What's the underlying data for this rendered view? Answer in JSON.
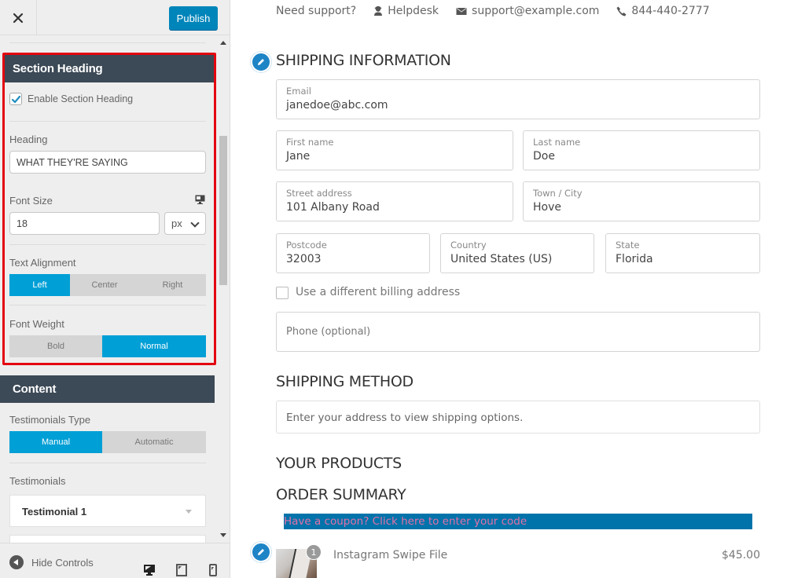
{
  "customizer": {
    "close_label": "Close",
    "publish_label": "Publish",
    "scroll_position": {
      "thumb_start_fraction": 0.18,
      "thumb_size_fraction": 0.31
    },
    "section_heading_panel": {
      "title": "Section Heading",
      "enable_checkbox": {
        "label": "Enable Section Heading",
        "checked": true
      },
      "heading": {
        "label": "Heading",
        "value": "WHAT THEY'RE SAYING"
      },
      "font_size": {
        "label": "Font Size",
        "value": "18",
        "unit": "px",
        "device_icon": "desktop-icon"
      },
      "text_alignment": {
        "label": "Text Alignment",
        "options": [
          "Left",
          "Center",
          "Right"
        ],
        "selected": "Left"
      },
      "font_weight": {
        "label": "Font Weight",
        "options": [
          "Bold",
          "Normal"
        ],
        "selected": "Normal"
      }
    },
    "content_panel": {
      "title": "Content",
      "testimonials_type": {
        "label": "Testimonials Type",
        "options": [
          "Manual",
          "Automatic"
        ],
        "selected": "Manual"
      },
      "testimonials": {
        "label": "Testimonials",
        "items": [
          "Testimonial 1"
        ]
      }
    },
    "footer": {
      "hide_controls_label": "Hide Controls",
      "devices": [
        "desktop",
        "tablet",
        "mobile"
      ],
      "active_device": "desktop"
    },
    "highlight_color": "#e3050f",
    "accent_color": "#009fd6"
  },
  "preview": {
    "support": {
      "prompt": "Need support?",
      "helpdesk": "Helpdesk",
      "email": "support@example.com",
      "phone": "844-440-2777"
    },
    "shipping_information": {
      "title": "SHIPPING INFORMATION",
      "fields": {
        "email": {
          "label": "Email",
          "value": "janedoe@abc.com"
        },
        "first_name": {
          "label": "First name",
          "value": "Jane"
        },
        "last_name": {
          "label": "Last name",
          "value": "Doe"
        },
        "street": {
          "label": "Street address",
          "value": "101 Albany Road"
        },
        "city": {
          "label": "Town / City",
          "value": "Hove"
        },
        "postcode": {
          "label": "Postcode",
          "value": "32003"
        },
        "country": {
          "label": "Country",
          "value": "United States (US)"
        },
        "state": {
          "label": "State",
          "value": "Florida"
        },
        "phone": {
          "placeholder": "Phone (optional)",
          "value": ""
        }
      },
      "billing_checkbox": {
        "label": "Use a different billing address",
        "checked": false
      }
    },
    "shipping_method": {
      "title": "SHIPPING METHOD",
      "message": "Enter your address to view shipping options."
    },
    "your_products": {
      "title": "YOUR PRODUCTS"
    },
    "order_summary": {
      "title": "ORDER SUMMARY",
      "coupon_text": "Have a coupon? Click here to enter your code",
      "items": [
        {
          "name": "Instagram Swipe File",
          "quantity": "1",
          "price": "$45.00"
        }
      ]
    }
  }
}
